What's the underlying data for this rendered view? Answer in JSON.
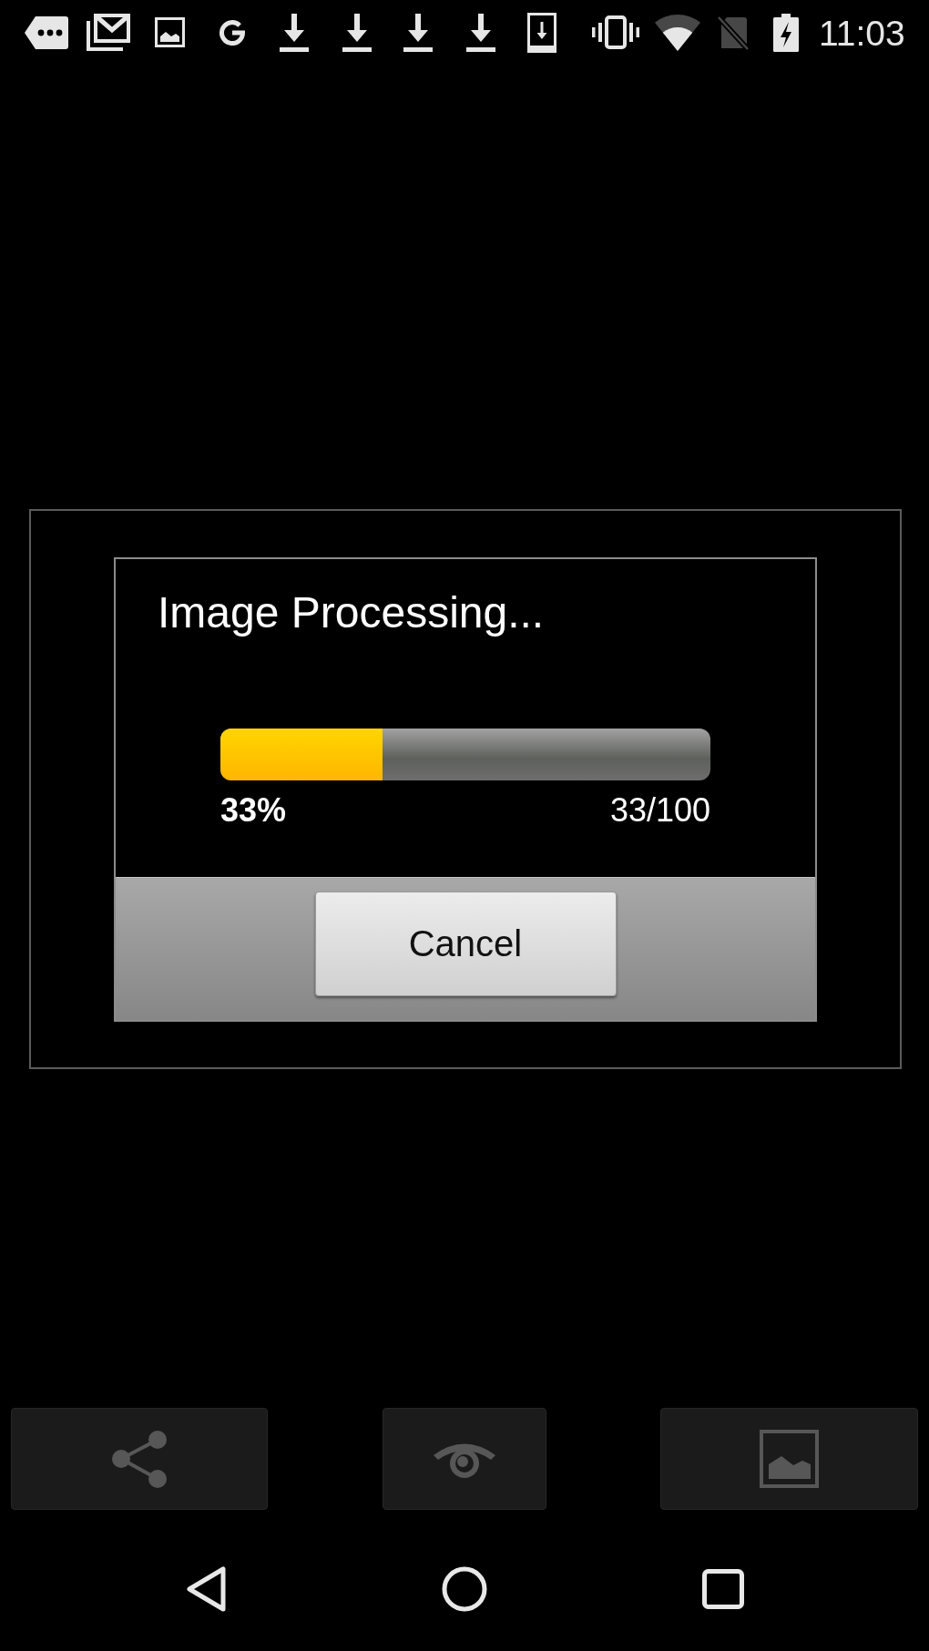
{
  "status_bar": {
    "time": "11:03"
  },
  "dialog": {
    "title": "Image Processing...",
    "progress": {
      "level": 0.33,
      "percent": "33%",
      "count": "33/100"
    },
    "buttons": [
      "Cancel"
    ]
  }
}
